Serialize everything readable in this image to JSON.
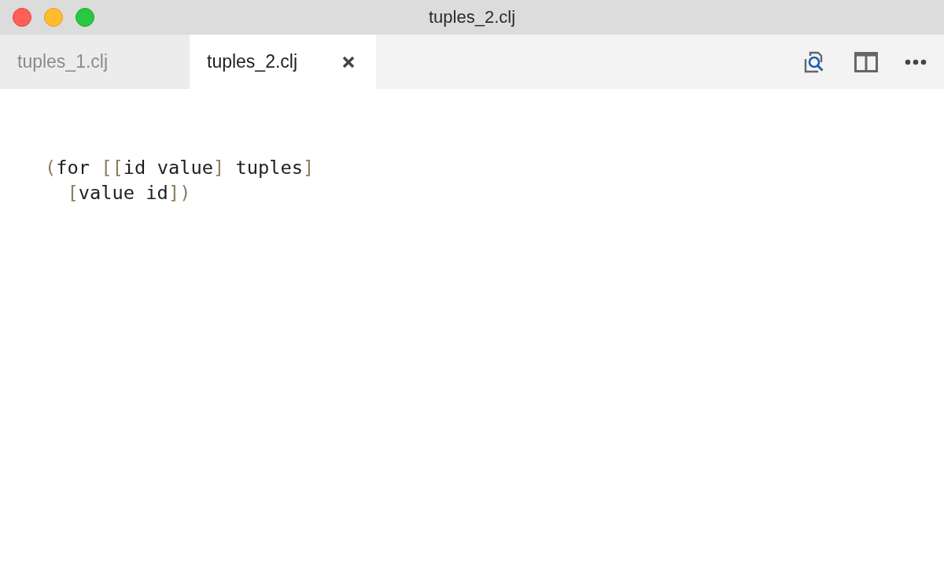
{
  "window": {
    "title": "tuples_2.clj"
  },
  "tabs": [
    {
      "label": "tuples_1.clj",
      "selected": false
    },
    {
      "label": "tuples_2.clj",
      "selected": true
    }
  ],
  "editor": {
    "lines": [
      [
        {
          "kind": "delimiter",
          "text": "("
        },
        {
          "kind": "code",
          "text": "for "
        },
        {
          "kind": "delimiter",
          "text": "[["
        },
        {
          "kind": "code",
          "text": "id value"
        },
        {
          "kind": "delimiter",
          "text": "]"
        },
        {
          "kind": "code",
          "text": " tuples"
        },
        {
          "kind": "delimiter",
          "text": "]"
        }
      ],
      [
        {
          "kind": "delimiter",
          "text": "  ["
        },
        {
          "kind": "code",
          "text": "value id"
        },
        {
          "kind": "delimiter",
          "text": "])"
        }
      ]
    ]
  }
}
